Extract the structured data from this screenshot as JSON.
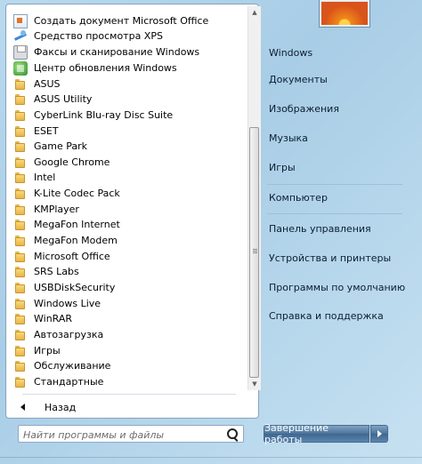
{
  "programs": [
    {
      "label": "Создать документ Microsoft Office",
      "icon": "office-doc-icon"
    },
    {
      "label": "Средство просмотра XPS",
      "icon": "xps-viewer-icon"
    },
    {
      "label": "Факсы и сканирование Windows",
      "icon": "fax-scan-icon"
    },
    {
      "label": "Центр обновления Windows",
      "icon": "windows-update-icon"
    },
    {
      "label": "ASUS",
      "icon": "folder-icon"
    },
    {
      "label": "ASUS Utility",
      "icon": "folder-icon"
    },
    {
      "label": "CyberLink Blu-ray Disc Suite",
      "icon": "folder-icon"
    },
    {
      "label": "ESET",
      "icon": "folder-icon"
    },
    {
      "label": "Game Park",
      "icon": "folder-icon"
    },
    {
      "label": "Google Chrome",
      "icon": "folder-icon"
    },
    {
      "label": "Intel",
      "icon": "folder-icon"
    },
    {
      "label": "K-Lite Codec Pack",
      "icon": "folder-icon"
    },
    {
      "label": "KMPlayer",
      "icon": "folder-icon"
    },
    {
      "label": "MegaFon Internet",
      "icon": "folder-icon"
    },
    {
      "label": "MegaFon Modem",
      "icon": "folder-icon"
    },
    {
      "label": "Microsoft Office",
      "icon": "folder-icon"
    },
    {
      "label": "SRS Labs",
      "icon": "folder-icon"
    },
    {
      "label": "USBDiskSecurity",
      "icon": "folder-icon"
    },
    {
      "label": "Windows Live",
      "icon": "folder-icon"
    },
    {
      "label": "WinRAR",
      "icon": "folder-icon"
    },
    {
      "label": "Автозагрузка",
      "icon": "folder-icon"
    },
    {
      "label": "Игры",
      "icon": "folder-icon"
    },
    {
      "label": "Обслуживание",
      "icon": "folder-icon"
    },
    {
      "label": "Стандартные",
      "icon": "folder-icon"
    }
  ],
  "back_label": "Назад",
  "search": {
    "placeholder": "Найти программы и файлы"
  },
  "right_links": [
    "Windows",
    "Документы",
    "Изображения",
    "Музыка",
    "Игры",
    "Компьютер",
    "Панель управления",
    "Устройства и принтеры",
    "Программы по умолчанию",
    "Справка и поддержка"
  ],
  "shutdown_label": "Завершение работы",
  "colors": {
    "accent": "#4c7399",
    "folder": "#e8b64a",
    "pane_bg": "#a8cde6"
  }
}
